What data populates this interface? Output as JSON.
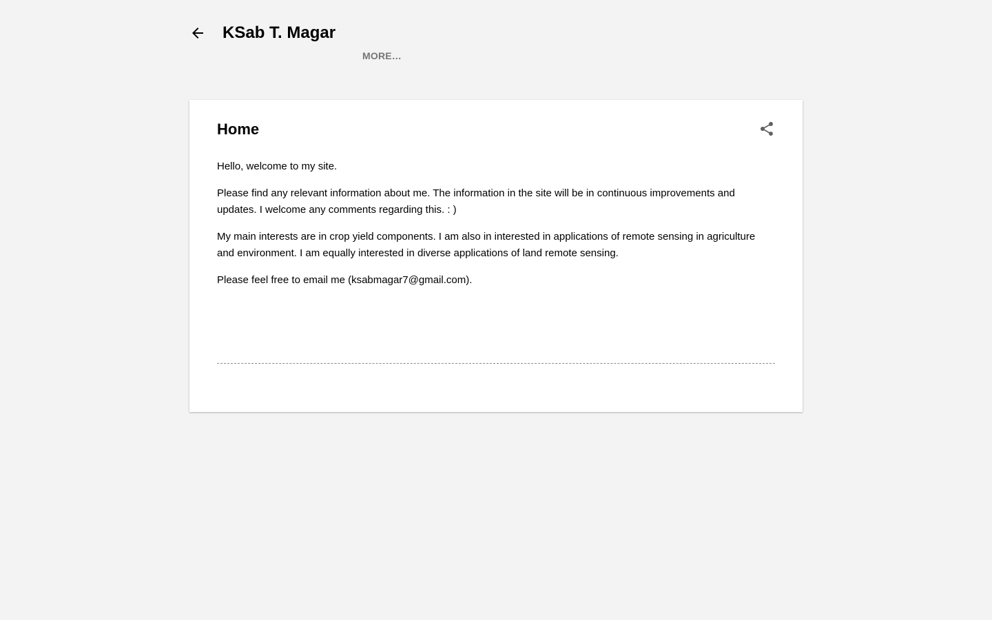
{
  "header": {
    "back_icon": "arrow-left-icon",
    "title": "KSab T. Magar",
    "more_label": "MORE…"
  },
  "post": {
    "title": "Home",
    "share_icon": "share-icon",
    "paragraphs": [
      "Hello, welcome to my site.",
      "Please find any relevant information about me. The information in the site will be in continuous improvements and updates. I welcome any comments regarding this. : )",
      "My main interests are in crop yield components. I am also in interested in applications of remote sensing in agriculture and environment. I am equally interested in diverse applications of land remote sensing.",
      "Please feel free to email me (ksabmagar7@gmail.com)."
    ]
  },
  "colors": {
    "background": "#f3f3f3",
    "card": "#ffffff",
    "muted_text": "#757575",
    "icon": "#616161"
  }
}
